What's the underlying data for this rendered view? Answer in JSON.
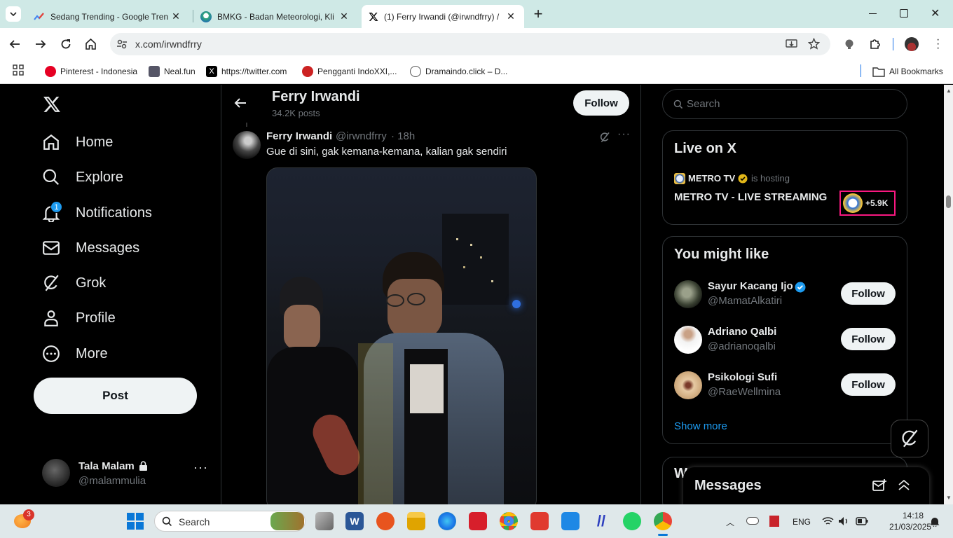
{
  "browser": {
    "tabs": [
      {
        "title": "Sedang Trending - Google Tren",
        "active": false
      },
      {
        "title": "BMKG - Badan Meteorologi, Kli",
        "active": false
      },
      {
        "title": "(1) Ferry Irwandi (@irwndfrry) /",
        "active": true
      }
    ],
    "url": "x.com/irwndfrry",
    "bookmarks": [
      "Pinterest - Indonesia",
      "Neal.fun",
      "https://twitter.com",
      "Pengganti IndoXXI,...",
      "Dramaindo.click – D..."
    ],
    "all_bookmarks": "All Bookmarks"
  },
  "nav": {
    "items": [
      {
        "label": "Home",
        "icon": "home-icon"
      },
      {
        "label": "Explore",
        "icon": "search-icon"
      },
      {
        "label": "Notifications",
        "icon": "bell-icon",
        "badge": "1"
      },
      {
        "label": "Messages",
        "icon": "mail-icon"
      },
      {
        "label": "Grok",
        "icon": "grok-icon"
      },
      {
        "label": "Profile",
        "icon": "person-icon"
      },
      {
        "label": "More",
        "icon": "more-circle-icon"
      }
    ],
    "post_label": "Post",
    "account": {
      "name": "Tala Malam",
      "handle": "@malammulia"
    }
  },
  "profile_header": {
    "name": "Ferry Irwandi",
    "posts": "34.2K posts",
    "follow_label": "Follow"
  },
  "tweet": {
    "name": "Ferry Irwandi",
    "handle": "@irwndfrry",
    "time": "· 18h",
    "text": "Gue di sini, gak kemana-kemana, kalian gak sendiri"
  },
  "search": {
    "placeholder": "Search"
  },
  "live": {
    "title": "Live on X",
    "host": "METRO TV",
    "hosting": "is hosting",
    "stream_title": "METRO TV - LIVE STREAMING",
    "listeners": "+5.9K"
  },
  "suggestions": {
    "title": "You might like",
    "users": [
      {
        "name": "Sayur Kacang Ijo",
        "handle": "@MamatAlkatiri",
        "verified": true
      },
      {
        "name": "Adriano Qalbi",
        "handle": "@adrianoqalbi",
        "verified": false
      },
      {
        "name": "Psikologi Sufi",
        "handle": "@RaeWellmina",
        "verified": false
      }
    ],
    "follow_label": "Follow",
    "show_more": "Show more"
  },
  "trends_partial": "W",
  "messages_drawer": {
    "title": "Messages"
  },
  "taskbar": {
    "search_placeholder": "Search",
    "lang": "ENG",
    "time": "14:18",
    "date": "21/03/2025",
    "weather_badge": "3"
  },
  "colors": {
    "accent": "#1d9bf0",
    "x_bg": "#000000",
    "tabbar": "#cfe9e6",
    "highlight": "#f91880"
  }
}
